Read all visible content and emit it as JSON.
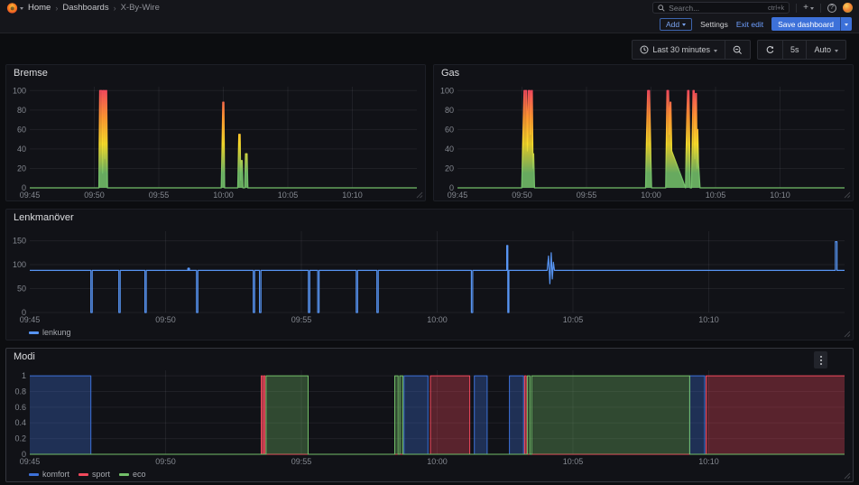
{
  "nav": {
    "breadcrumb": [
      {
        "label": "Home"
      },
      {
        "label": "Dashboards"
      },
      {
        "label": "X-By-Wire"
      }
    ],
    "breadcrumb_separator": "›",
    "search_placeholder": "Search...",
    "search_shortcut": "ctrl+k",
    "plus_icon": "+"
  },
  "toolbar": {
    "add_label": "Add",
    "settings_label": "Settings",
    "exit_edit_label": "Exit edit",
    "save_label": "Save dashboard"
  },
  "time_controls": {
    "range_label": "Last 30 minutes",
    "interval_label": "5s",
    "refresh_label": "Auto"
  },
  "colors": {
    "accent_blue": "#3D71D9",
    "link_blue": "#6e9fff",
    "series_blue": "#5794F2",
    "green": "#73BF69",
    "yellow": "#FADE2A",
    "orange": "#FF9830",
    "red": "#F2495C"
  },
  "chart_data": [
    {
      "title": "Bremse",
      "type": "area",
      "gradient_colors": [
        "#F2495C",
        "#FF9830",
        "#FADE2A",
        "#73BF69"
      ],
      "x_range_minutes": 30,
      "x_ticks": [
        {
          "minute": 0,
          "label": "09:45"
        },
        {
          "minute": 5,
          "label": "09:50"
        },
        {
          "minute": 10,
          "label": "09:55"
        },
        {
          "minute": 15,
          "label": "10:00"
        },
        {
          "minute": 20,
          "label": "10:05"
        },
        {
          "minute": 25,
          "label": "10:10"
        }
      ],
      "y_ticks": [
        0,
        20,
        40,
        60,
        80,
        100
      ],
      "ylim": [
        0,
        104
      ],
      "points": [
        [
          0,
          0
        ],
        [
          5.36,
          0
        ],
        [
          5.42,
          100
        ],
        [
          5.6,
          100
        ],
        [
          5.64,
          15
        ],
        [
          5.68,
          100
        ],
        [
          5.78,
          100
        ],
        [
          5.82,
          30
        ],
        [
          5.86,
          100
        ],
        [
          5.96,
          100
        ],
        [
          6.02,
          0
        ],
        [
          14.84,
          0
        ],
        [
          14.9,
          40
        ],
        [
          14.96,
          88
        ],
        [
          15.04,
          88
        ],
        [
          15.1,
          0
        ],
        [
          16.12,
          0
        ],
        [
          16.2,
          55
        ],
        [
          16.3,
          55
        ],
        [
          16.34,
          8
        ],
        [
          16.38,
          28
        ],
        [
          16.46,
          28
        ],
        [
          16.52,
          0
        ],
        [
          16.66,
          0
        ],
        [
          16.72,
          35
        ],
        [
          16.84,
          35
        ],
        [
          16.9,
          0
        ],
        [
          30,
          0
        ]
      ]
    },
    {
      "title": "Gas",
      "type": "area",
      "gradient_colors": [
        "#F2495C",
        "#FF9830",
        "#FADE2A",
        "#73BF69"
      ],
      "x_range_minutes": 30,
      "x_ticks": [
        {
          "minute": 0,
          "label": "09:45"
        },
        {
          "minute": 5,
          "label": "09:50"
        },
        {
          "minute": 10,
          "label": "09:55"
        },
        {
          "minute": 15,
          "label": "10:00"
        },
        {
          "minute": 20,
          "label": "10:05"
        },
        {
          "minute": 25,
          "label": "10:10"
        }
      ],
      "y_ticks": [
        0,
        20,
        40,
        60,
        80,
        100
      ],
      "ylim": [
        0,
        104
      ],
      "points": [
        [
          0,
          0
        ],
        [
          4.98,
          0
        ],
        [
          5.08,
          55
        ],
        [
          5.16,
          100
        ],
        [
          5.36,
          100
        ],
        [
          5.42,
          38
        ],
        [
          5.5,
          100
        ],
        [
          5.62,
          100
        ],
        [
          5.66,
          55
        ],
        [
          5.72,
          100
        ],
        [
          5.8,
          100
        ],
        [
          5.85,
          20
        ],
        [
          5.9,
          35
        ],
        [
          5.97,
          0
        ],
        [
          14.58,
          0
        ],
        [
          14.66,
          55
        ],
        [
          14.74,
          100
        ],
        [
          14.88,
          100
        ],
        [
          14.98,
          35
        ],
        [
          15.04,
          0
        ],
        [
          16.14,
          0
        ],
        [
          16.24,
          100
        ],
        [
          16.36,
          100
        ],
        [
          16.42,
          55
        ],
        [
          16.48,
          88
        ],
        [
          16.54,
          88
        ],
        [
          16.6,
          38
        ],
        [
          17.68,
          0
        ],
        [
          17.72,
          36
        ],
        [
          17.78,
          75
        ],
        [
          17.84,
          100
        ],
        [
          17.94,
          100
        ],
        [
          18.0,
          38
        ],
        [
          18.04,
          0
        ],
        [
          18.14,
          0
        ],
        [
          18.2,
          55
        ],
        [
          18.26,
          100
        ],
        [
          18.34,
          100
        ],
        [
          18.4,
          30
        ],
        [
          18.45,
          97
        ],
        [
          18.52,
          97
        ],
        [
          18.57,
          20
        ],
        [
          18.62,
          60
        ],
        [
          18.68,
          25
        ],
        [
          18.74,
          12
        ],
        [
          18.8,
          0
        ],
        [
          30,
          0
        ]
      ]
    },
    {
      "title": "Lenkmanöver",
      "type": "line",
      "color": "#5794F2",
      "legend": [
        {
          "label": "lenkung",
          "color": "#5794F2"
        }
      ],
      "x_range_minutes": 30,
      "x_ticks": [
        {
          "minute": 0,
          "label": "09:45"
        },
        {
          "minute": 5,
          "label": "09:50"
        },
        {
          "minute": 10,
          "label": "09:55"
        },
        {
          "minute": 15,
          "label": "10:00"
        },
        {
          "minute": 20,
          "label": "10:05"
        },
        {
          "minute": 25,
          "label": "10:10"
        }
      ],
      "y_ticks": [
        0,
        50,
        100,
        150
      ],
      "ylim": [
        0,
        170
      ],
      "marker": {
        "minute": 5.85,
        "value": 91
      },
      "points": [
        [
          0,
          88
        ],
        [
          2.25,
          88
        ],
        [
          2.25,
          0
        ],
        [
          2.3,
          0
        ],
        [
          2.3,
          88
        ],
        [
          3.28,
          88
        ],
        [
          3.28,
          0
        ],
        [
          3.33,
          0
        ],
        [
          3.33,
          88
        ],
        [
          4.24,
          88
        ],
        [
          4.24,
          0
        ],
        [
          4.29,
          0
        ],
        [
          4.29,
          88
        ],
        [
          6.14,
          88
        ],
        [
          6.14,
          0
        ],
        [
          6.19,
          0
        ],
        [
          6.19,
          88
        ],
        [
          8.23,
          88
        ],
        [
          8.23,
          0
        ],
        [
          8.28,
          0
        ],
        [
          8.28,
          88
        ],
        [
          8.46,
          88
        ],
        [
          8.46,
          0
        ],
        [
          8.51,
          0
        ],
        [
          8.51,
          88
        ],
        [
          10.26,
          88
        ],
        [
          10.26,
          0
        ],
        [
          10.31,
          0
        ],
        [
          10.31,
          88
        ],
        [
          10.6,
          88
        ],
        [
          10.6,
          0
        ],
        [
          10.65,
          0
        ],
        [
          10.65,
          88
        ],
        [
          12.02,
          88
        ],
        [
          12.02,
          0
        ],
        [
          12.07,
          0
        ],
        [
          12.07,
          88
        ],
        [
          12.78,
          88
        ],
        [
          12.78,
          0
        ],
        [
          12.83,
          0
        ],
        [
          12.83,
          88
        ],
        [
          16.26,
          88
        ],
        [
          16.26,
          0
        ],
        [
          16.31,
          0
        ],
        [
          16.31,
          88
        ],
        [
          17.56,
          88
        ],
        [
          17.56,
          140
        ],
        [
          17.6,
          140
        ],
        [
          17.6,
          0
        ],
        [
          17.64,
          0
        ],
        [
          17.64,
          88
        ],
        [
          19.05,
          88
        ],
        [
          19.1,
          118
        ],
        [
          19.15,
          60
        ],
        [
          19.2,
          125
        ],
        [
          19.24,
          70
        ],
        [
          19.28,
          105
        ],
        [
          19.32,
          88
        ],
        [
          29.66,
          88
        ],
        [
          29.66,
          148
        ],
        [
          29.72,
          148
        ],
        [
          29.72,
          88
        ],
        [
          30,
          88
        ]
      ]
    },
    {
      "title": "Modi",
      "type": "state",
      "x_range_minutes": 30,
      "x_ticks": [
        {
          "minute": 0,
          "label": "09:45"
        },
        {
          "minute": 5,
          "label": "09:50"
        },
        {
          "minute": 10,
          "label": "09:55"
        },
        {
          "minute": 15,
          "label": "10:00"
        },
        {
          "minute": 20,
          "label": "10:05"
        },
        {
          "minute": 25,
          "label": "10:10"
        }
      ],
      "y_ticks": [
        0,
        0.2,
        0.4,
        0.6,
        0.8,
        1
      ],
      "ylim": [
        0,
        1.07
      ],
      "legend": [
        {
          "label": "komfort",
          "color": "#3D71D9"
        },
        {
          "label": "sport",
          "color": "#F2495C"
        },
        {
          "label": "eco",
          "color": "#73BF69"
        }
      ],
      "series": [
        {
          "name": "komfort",
          "color": "#3D71D9",
          "blocks": [
            [
              0,
              2.25
            ],
            [
              13.78,
              14.66
            ],
            [
              16.37,
              16.84
            ],
            [
              17.66,
              18.18
            ],
            [
              24.3,
              24.85
            ]
          ]
        },
        {
          "name": "sport",
          "color": "#F2495C",
          "blocks": [
            [
              8.52,
              8.57
            ],
            [
              8.61,
              8.66
            ],
            [
              14.75,
              16.2
            ],
            [
              18.22,
              18.28
            ],
            [
              24.9,
              30
            ]
          ]
        },
        {
          "name": "eco",
          "color": "#73BF69",
          "blocks": [
            [
              8.7,
              10.25
            ],
            [
              13.44,
              13.56
            ],
            [
              13.62,
              13.74
            ],
            [
              18.32,
              18.42
            ],
            [
              18.48,
              24.3
            ]
          ]
        }
      ]
    }
  ]
}
